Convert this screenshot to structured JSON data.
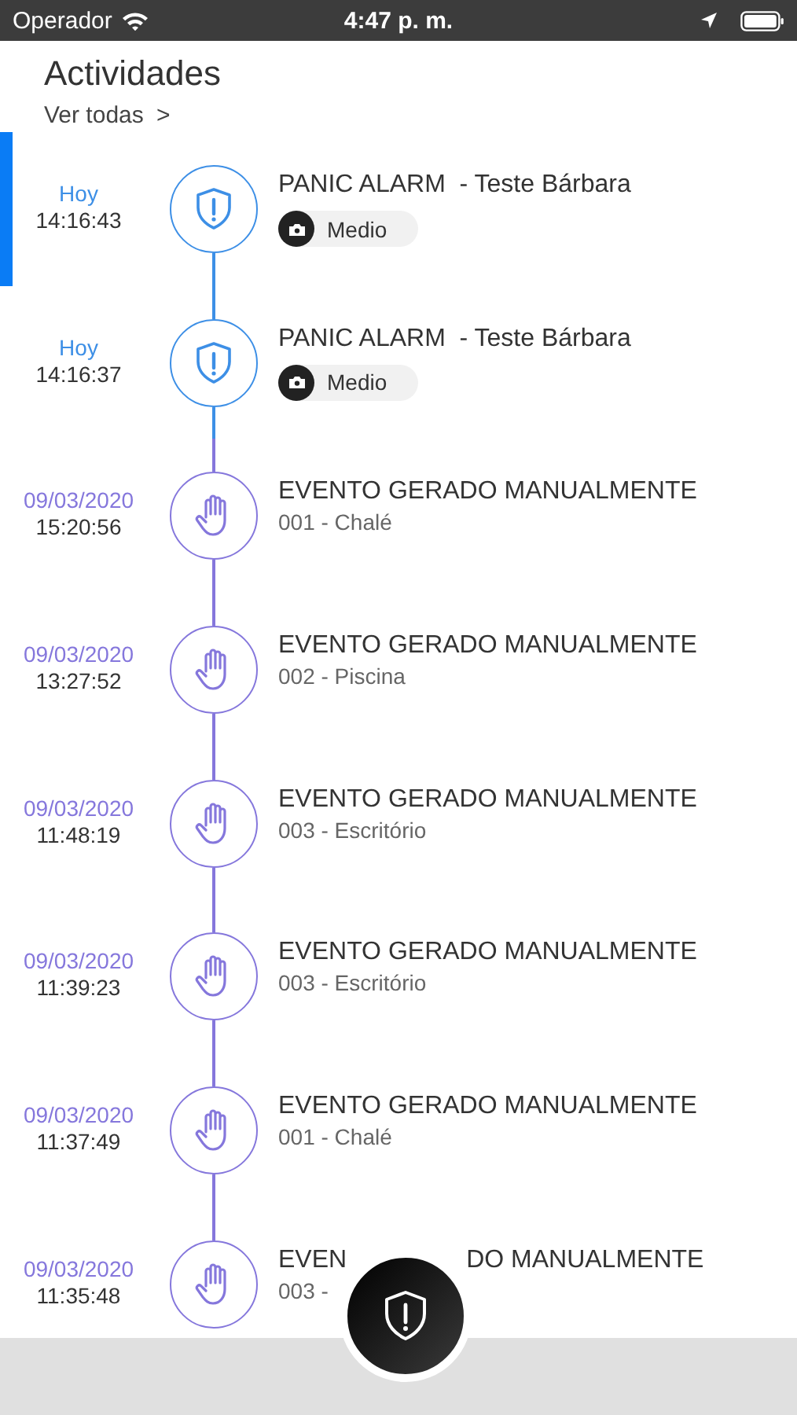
{
  "status_bar": {
    "carrier": "Operador",
    "time": "4:47 p. m."
  },
  "header": {
    "title": "Actividades",
    "link": "Ver todas",
    "chevron": ">"
  },
  "events": [
    {
      "kind": "alarm",
      "selected": true,
      "day": "Hoy",
      "time": "14:16:43",
      "title": "PANIC ALARM  - Teste Bárbara",
      "badge": "Medio"
    },
    {
      "kind": "alarm",
      "selected": false,
      "day": "Hoy",
      "time": "14:16:37",
      "title": "PANIC ALARM  - Teste Bárbara",
      "badge": "Medio"
    },
    {
      "kind": "manual",
      "selected": false,
      "day": "09/03/2020",
      "time": "15:20:56",
      "title": "EVENTO GERADO MANUALMENTE",
      "detail": "001 - Chalé"
    },
    {
      "kind": "manual",
      "selected": false,
      "day": "09/03/2020",
      "time": "13:27:52",
      "title": "EVENTO GERADO MANUALMENTE",
      "detail": "002 - Piscina"
    },
    {
      "kind": "manual",
      "selected": false,
      "day": "09/03/2020",
      "time": "11:48:19",
      "title": "EVENTO GERADO MANUALMENTE",
      "detail": "003 - Escritório"
    },
    {
      "kind": "manual",
      "selected": false,
      "day": "09/03/2020",
      "time": "11:39:23",
      "title": "EVENTO GERADO MANUALMENTE",
      "detail": "003 - Escritório"
    },
    {
      "kind": "manual",
      "selected": false,
      "day": "09/03/2020",
      "time": "11:37:49",
      "title": "EVENTO GERADO MANUALMENTE",
      "detail": "001 - Chalé"
    },
    {
      "kind": "manual",
      "selected": false,
      "day": "09/03/2020",
      "time": "11:35:48",
      "title_parts": [
        "EVEN",
        "DO MANUALMENTE"
      ],
      "detail": "003 -"
    }
  ]
}
